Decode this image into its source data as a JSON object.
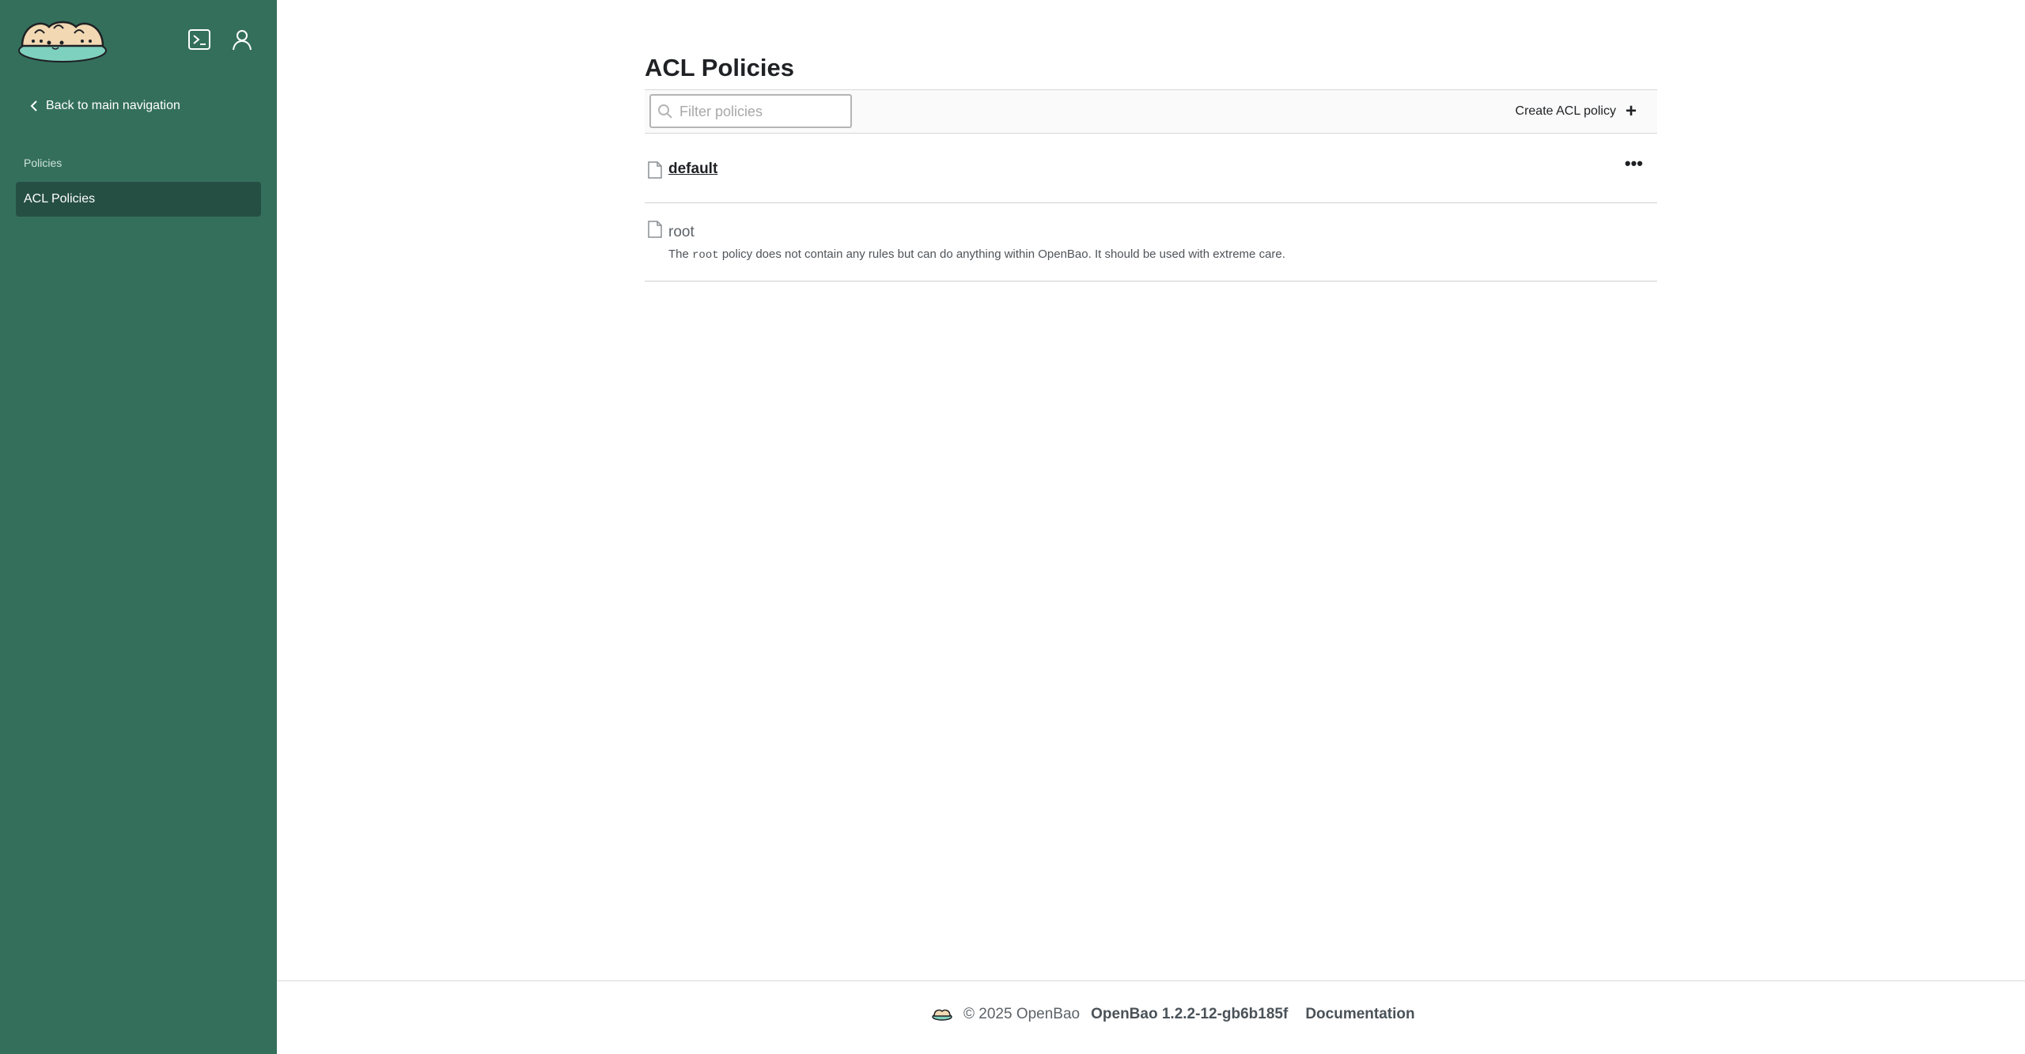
{
  "sidebar": {
    "logo_icon": "openbao-logo",
    "terminal_icon": "terminal-icon",
    "user_icon": "user-icon",
    "back_link": "Back to main navigation",
    "section_label": "Policies",
    "nav_items": [
      {
        "label": "ACL Policies",
        "active": true
      }
    ]
  },
  "main": {
    "title": "ACL Policies",
    "search": {
      "placeholder": "Filter policies",
      "value": ""
    },
    "create_button": "Create ACL policy",
    "policies": [
      {
        "name": "default",
        "linked": true,
        "has_menu": true
      },
      {
        "name": "root",
        "linked": false,
        "desc_prefix": "The",
        "desc_code": "root",
        "desc_suffix": "policy does not contain any rules but can do anything within OpenBao. It should be used with extreme care."
      }
    ]
  },
  "footer": {
    "copyright": "© 2025 OpenBao",
    "version": "OpenBao 1.2.2-12-gb6b185f",
    "docs_link": "Documentation"
  },
  "colors": {
    "sidebar_bg": "#346f5c",
    "sidebar_active": "#264f44",
    "text": "#1f2124"
  }
}
